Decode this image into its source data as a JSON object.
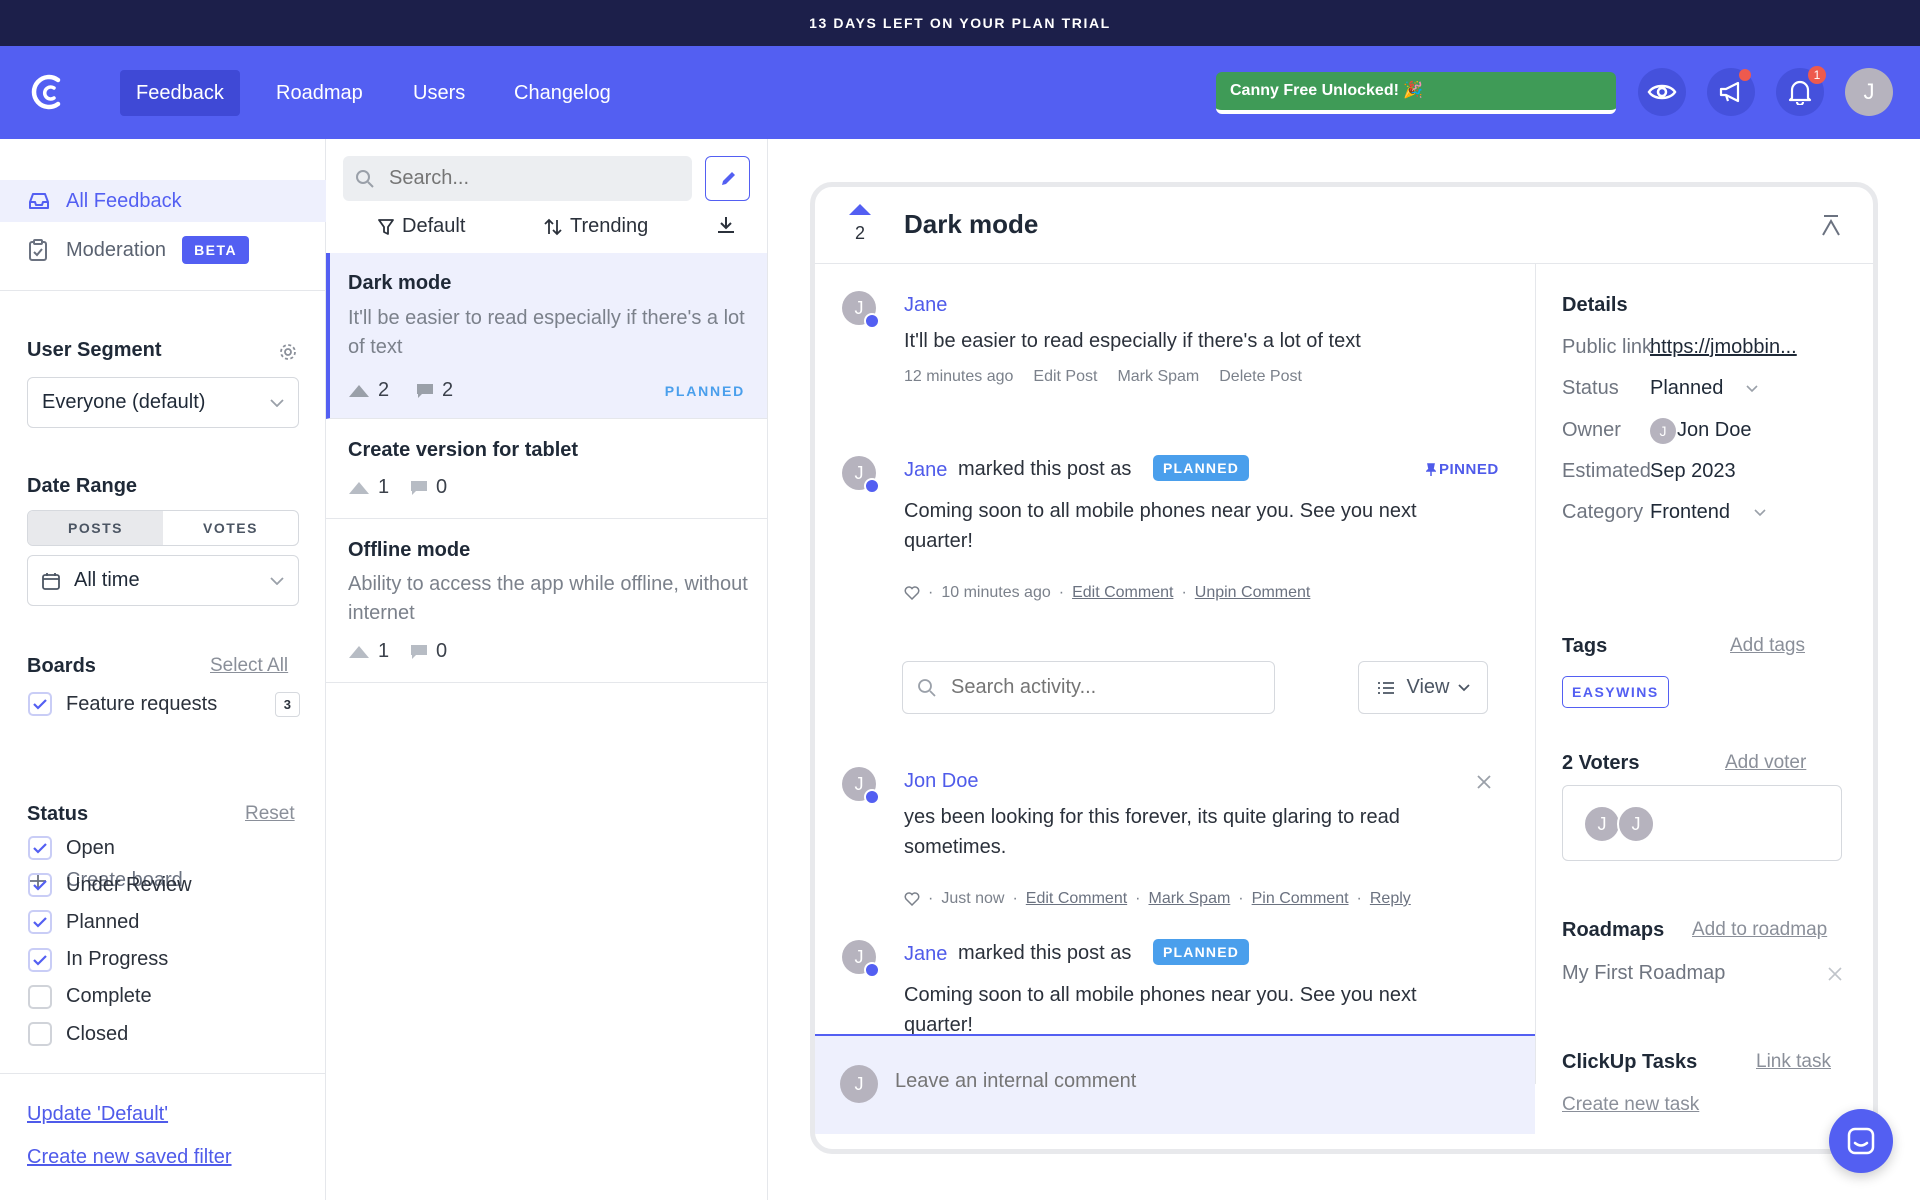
{
  "banner": {
    "text": "13 DAYS LEFT ON YOUR PLAN TRIAL"
  },
  "header": {
    "nav": [
      "Feedback",
      "Roadmap",
      "Users",
      "Changelog"
    ],
    "unlocked_label": "Canny Free Unlocked! 🎉",
    "notification_count": "1",
    "avatar_letter": "J"
  },
  "sidebar": {
    "items": [
      {
        "label": "All Feedback",
        "icon": "inbox-icon"
      },
      {
        "label": "Moderation",
        "icon": "clipboard-icon",
        "badge": "BETA"
      }
    ],
    "user_segment": {
      "title": "User Segment",
      "value": "Everyone (default)"
    },
    "date_range": {
      "title": "Date Range",
      "toggle": [
        "POSTS",
        "VOTES"
      ],
      "value": "All time"
    },
    "boards": {
      "title": "Boards",
      "select_all": "Select All",
      "items": [
        {
          "label": "Feature requests",
          "count": "3"
        }
      ],
      "create_label": "Create board"
    },
    "status": {
      "title": "Status",
      "reset": "Reset",
      "items": [
        {
          "label": "Open",
          "checked": true
        },
        {
          "label": "Under Review",
          "checked": true
        },
        {
          "label": "Planned",
          "checked": true
        },
        {
          "label": "In Progress",
          "checked": true
        },
        {
          "label": "Complete",
          "checked": false
        },
        {
          "label": "Closed",
          "checked": false
        }
      ]
    },
    "update_filter": "Update 'Default'",
    "create_filter": "Create new saved filter"
  },
  "list": {
    "search_placeholder": "Search...",
    "filter_label": "Default",
    "sort_label": "Trending",
    "posts": [
      {
        "title": "Dark mode",
        "desc": "It'll be easier to read especially if there's a lot of text",
        "votes": "2",
        "comments": "2",
        "status": "PLANNED"
      },
      {
        "title": "Create version for tablet",
        "desc": "",
        "votes": "1",
        "comments": "0",
        "status": ""
      },
      {
        "title": "Offline mode",
        "desc": "Ability to access the app while offline, without internet",
        "votes": "1",
        "comments": "0",
        "status": ""
      }
    ]
  },
  "detail": {
    "votes": "2",
    "title": "Dark mode",
    "post": {
      "author": "Jane",
      "text": "It'll be easier to read especially if there's a lot of text",
      "time": "12 minutes ago",
      "actions": [
        "Edit Post",
        "Mark Spam",
        "Delete Post"
      ]
    },
    "pinned_activity": {
      "author": "Jane",
      "action": "marked this post as",
      "status": "PLANNED",
      "pinned": "PINNED",
      "text": "Coming soon to all mobile phones near you. See you next quarter!",
      "time": "10 minutes ago",
      "actions": [
        "Edit Comment",
        "Unpin Comment"
      ]
    },
    "search_activity_placeholder": "Search activity...",
    "view_label": "View",
    "comment": {
      "author": "Jon Doe",
      "text": "yes been looking for this forever, its quite glaring to read sometimes.",
      "time": "Just now",
      "actions": [
        "Edit Comment",
        "Mark Spam",
        "Pin Comment",
        "Reply"
      ]
    },
    "status_activity": {
      "author": "Jane",
      "action": "marked this post as",
      "status": "PLANNED",
      "text": "Coming soon to all mobile phones near you. See you next quarter!"
    },
    "internal_comment_placeholder": "Leave an internal comment",
    "avatar_letter": "J"
  },
  "details_panel": {
    "title": "Details",
    "rows": [
      {
        "label": "Public link",
        "value": "https://jmobbin..."
      },
      {
        "label": "Status",
        "value": "Planned"
      },
      {
        "label": "Owner",
        "value": "Jon Doe"
      },
      {
        "label": "Estimated",
        "value": "Sep 2023"
      },
      {
        "label": "Category",
        "value": "Frontend"
      }
    ],
    "tags": {
      "title": "Tags",
      "add": "Add tags",
      "items": [
        "EASYWINS"
      ]
    },
    "voters": {
      "title": "2 Voters",
      "add": "Add voter"
    },
    "roadmaps": {
      "title": "Roadmaps",
      "add": "Add to roadmap",
      "items": [
        "My First Roadmap"
      ]
    },
    "clickup": {
      "title": "ClickUp Tasks",
      "link": "Link task",
      "create": "Create new task"
    }
  },
  "colors": {
    "brand": "#535ff2",
    "banner": "#1c1f4a",
    "planned": "#4a9fec",
    "unlocked": "#3f9b57"
  }
}
